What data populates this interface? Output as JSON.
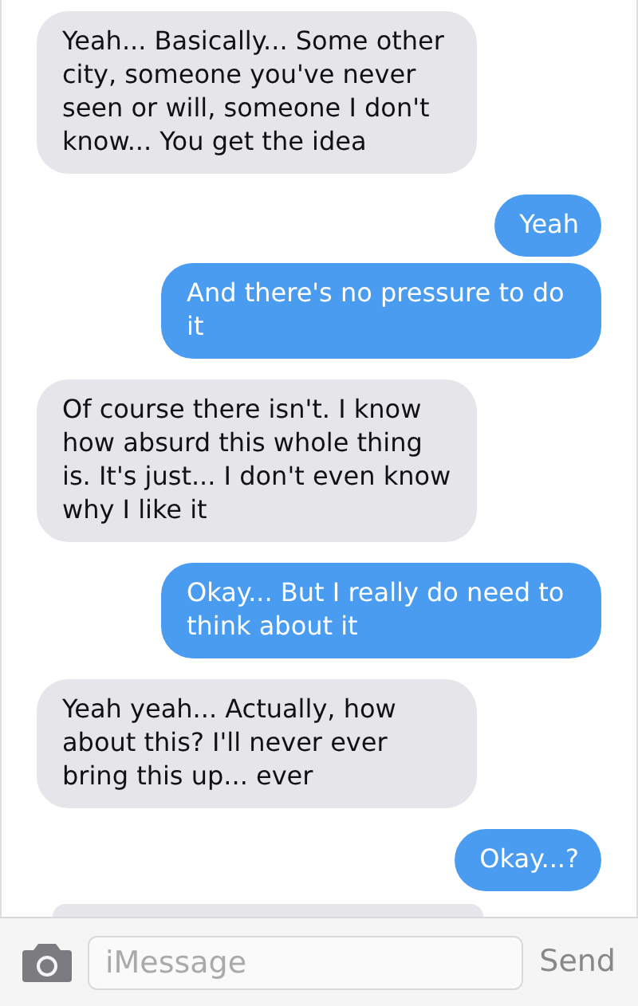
{
  "messages": [
    {
      "text": "Yeah... Basically... Some other city, someone you've never seen or will, someone I don't know... You get the idea",
      "sent": false
    },
    {
      "text": "Yeah",
      "sent": true
    },
    {
      "text": "And there's no pressure to do it",
      "sent": true
    },
    {
      "text": "Of course there isn't. I know how absurd this whole thing is. It's just... I don't even know why I like it",
      "sent": false
    },
    {
      "text": "Okay... But I really do need to think about it",
      "sent": true
    },
    {
      "text": "Yeah yeah... Actually, how about this? I'll never ever bring this up... ever",
      "sent": false
    },
    {
      "text": "Okay...?",
      "sent": true
    }
  ],
  "composer": {
    "placeholder": "iMessage",
    "send": "Send"
  }
}
